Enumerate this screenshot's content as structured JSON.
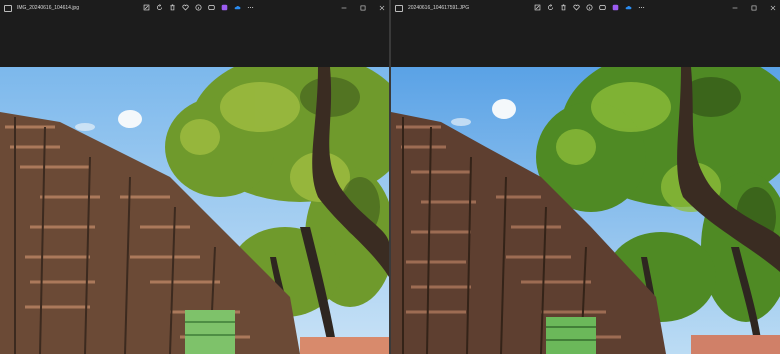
{
  "windows": [
    {
      "title": "IMG_20240616_104614.jpg",
      "toolbar_icons": [
        "edit-icon",
        "rotate-icon",
        "delete-icon",
        "favorite-icon",
        "info-icon",
        "copilot-icon",
        "app-icon",
        "cloud-icon",
        "more-icon"
      ],
      "caption_icons": [
        "minimize-icon",
        "maximize-icon",
        "close-icon"
      ]
    },
    {
      "title": "20240616_104617591.JPG",
      "toolbar_icons": [
        "edit-icon",
        "rotate-icon",
        "delete-icon",
        "favorite-icon",
        "info-icon",
        "copilot-icon",
        "app-icon",
        "cloud-icon",
        "more-icon"
      ],
      "caption_icons": [
        "minimize-icon",
        "maximize-icon",
        "close-icon"
      ]
    }
  ],
  "colors": {
    "background": "#1c1c1c",
    "sky": "#8ec3ee",
    "foliage": "#6f9a2c",
    "chairs": "#8b5a40",
    "copilot": "#9b5cf0",
    "cloud": "#2a8cf0"
  }
}
